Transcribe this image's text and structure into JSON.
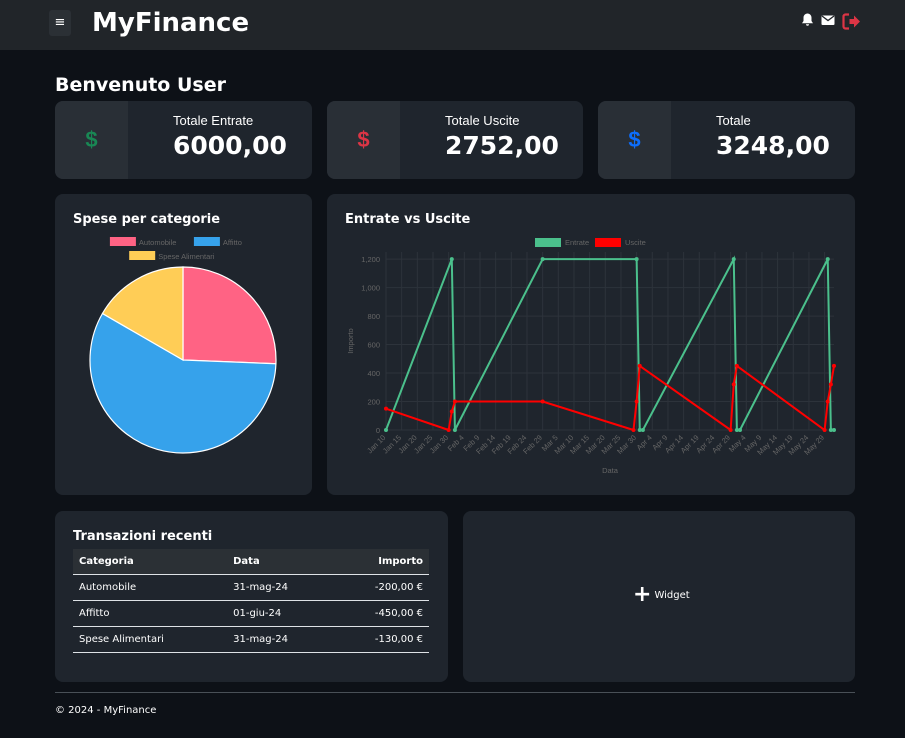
{
  "app": {
    "menu_glyph": "≡",
    "brand": "MyFinance"
  },
  "nav": {
    "icons": [
      "bell-icon",
      "envelope-icon",
      "logout-icon"
    ]
  },
  "welcome": "Benvenuto User",
  "stats": [
    {
      "label": "Totale Entrate",
      "value": "6000,00",
      "symbol": "$",
      "color": "#198754"
    },
    {
      "label": "Totale Uscite",
      "value": "2752,00",
      "symbol": "$",
      "color": "#dc3545"
    },
    {
      "label": "Totale",
      "value": "3248,00",
      "symbol": "$",
      "color": "#0d6efd"
    }
  ],
  "pie_card": {
    "title": "Spese per categorie"
  },
  "line_card": {
    "title": "Entrate vs Uscite"
  },
  "chart_data": [
    {
      "type": "pie",
      "legend_placement": "top",
      "categories": [
        "Automobile",
        "Affitto",
        "Spese Alimentari"
      ],
      "values": [
        200,
        450,
        130
      ],
      "colors": [
        "#ff6384",
        "#36a2eb",
        "#ffcd56"
      ]
    },
    {
      "type": "line",
      "legend_placement": "top",
      "xlabel": "Data",
      "ylabel": "Importo",
      "ylim": [
        0,
        1250
      ],
      "yticks": [
        "0",
        "200",
        "400",
        "600",
        "800",
        "1,000",
        "1,200"
      ],
      "xticks": [
        "Jan 10",
        "Jan 15",
        "Jan 20",
        "Jan 25",
        "Jan 30",
        "Feb 4",
        "Feb 9",
        "Feb 14",
        "Feb 19",
        "Feb 24",
        "Feb 29",
        "Mar 5",
        "Mar 10",
        "Mar 15",
        "Mar 20",
        "Mar 25",
        "Mar 30",
        "Apr 4",
        "Apr 9",
        "Apr 14",
        "Apr 19",
        "Apr 24",
        "Apr 29",
        "May 4",
        "May 9",
        "May 14",
        "May 19",
        "May 24",
        "May 29"
      ],
      "grid": true,
      "series": [
        {
          "name": "Entrate",
          "color": "#4bc08c",
          "points": [
            [
              "2024-01-10",
              0
            ],
            [
              "2024-01-31",
              1200
            ],
            [
              "2024-02-01",
              0
            ],
            [
              "2024-02-29",
              1200
            ],
            [
              "2024-03-30",
              1200
            ],
            [
              "2024-03-31",
              0
            ],
            [
              "2024-04-01",
              0
            ],
            [
              "2024-04-30",
              1200
            ],
            [
              "2024-05-01",
              0
            ],
            [
              "2024-05-02",
              0
            ],
            [
              "2024-05-30",
              1200
            ],
            [
              "2024-05-31",
              0
            ],
            [
              "2024-06-01",
              0
            ]
          ]
        },
        {
          "name": "Uscite",
          "color": "#ff0000",
          "points": [
            [
              "2024-01-10",
              150
            ],
            [
              "2024-01-30",
              0
            ],
            [
              "2024-01-31",
              130
            ],
            [
              "2024-02-01",
              200
            ],
            [
              "2024-02-29",
              200
            ],
            [
              "2024-03-29",
              0
            ],
            [
              "2024-03-30",
              200
            ],
            [
              "2024-03-31",
              450
            ],
            [
              "2024-04-29",
              0
            ],
            [
              "2024-04-30",
              320
            ],
            [
              "2024-05-01",
              450
            ],
            [
              "2024-05-29",
              0
            ],
            [
              "2024-05-30",
              200
            ],
            [
              "2024-05-31",
              320
            ],
            [
              "2024-06-01",
              450
            ]
          ]
        }
      ]
    }
  ],
  "transactions": {
    "title": "Transazioni recenti",
    "headers": [
      "Categoria",
      "Data",
      "Importo"
    ],
    "rows": [
      [
        "Automobile",
        "31-mag-24",
        "-200,00 €"
      ],
      [
        "Affitto",
        "01-giu-24",
        "-450,00 €"
      ],
      [
        "Spese Alimentari",
        "31-mag-24",
        "-130,00 €"
      ]
    ]
  },
  "widget": {
    "label": "Widget"
  },
  "footer": "© 2024 - MyFinance"
}
